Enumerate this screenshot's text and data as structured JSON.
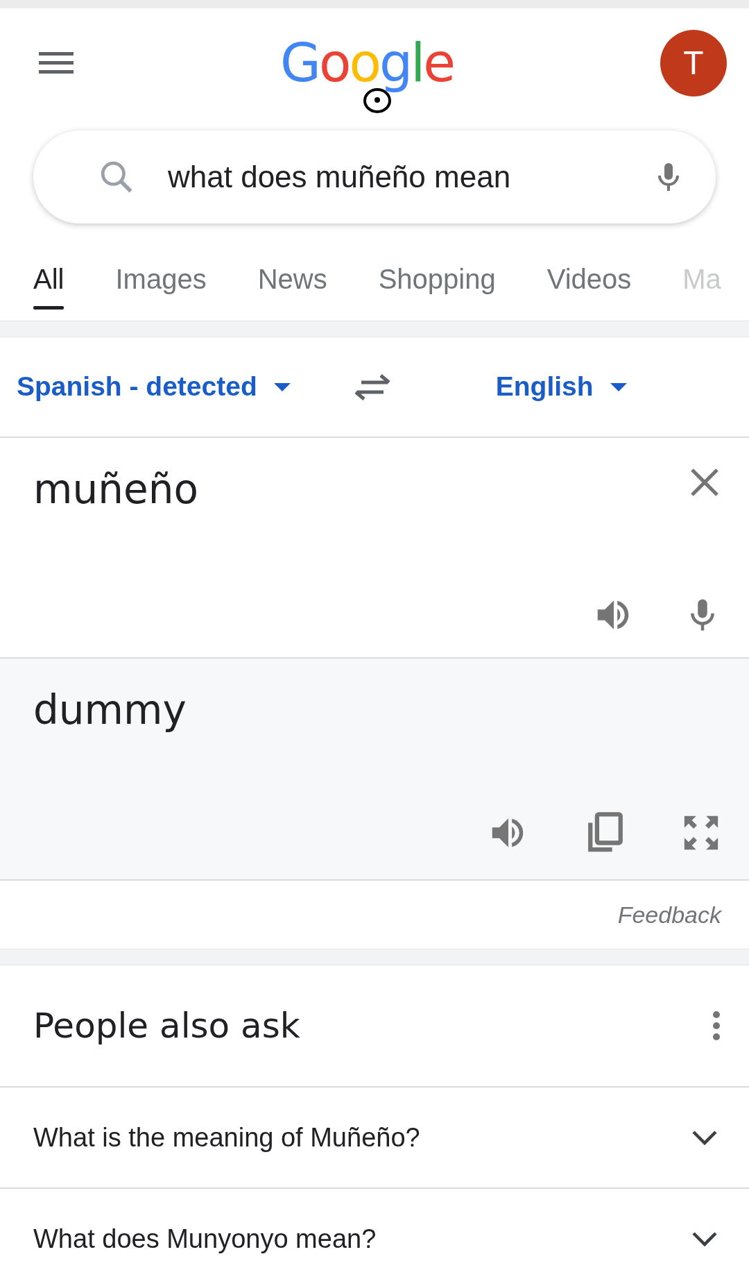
{
  "header": {
    "logo": "Google",
    "avatar_letter": "T"
  },
  "search": {
    "value": "what does muñeño mean"
  },
  "tabs": [
    {
      "label": "All",
      "selected": true
    },
    {
      "label": "Images",
      "selected": false
    },
    {
      "label": "News",
      "selected": false
    },
    {
      "label": "Shopping",
      "selected": false
    },
    {
      "label": "Videos",
      "selected": false
    },
    {
      "label": "Ma",
      "selected": false
    }
  ],
  "translate": {
    "source_language": "Spanish - detected",
    "target_language": "English",
    "source_text": "muñeño",
    "translation": "dummy",
    "feedback": "Feedback"
  },
  "people_also_ask": {
    "title": "People also ask",
    "questions": [
      "What is the meaning of Muñeño?",
      "What does Munyonyo mean?"
    ]
  }
}
